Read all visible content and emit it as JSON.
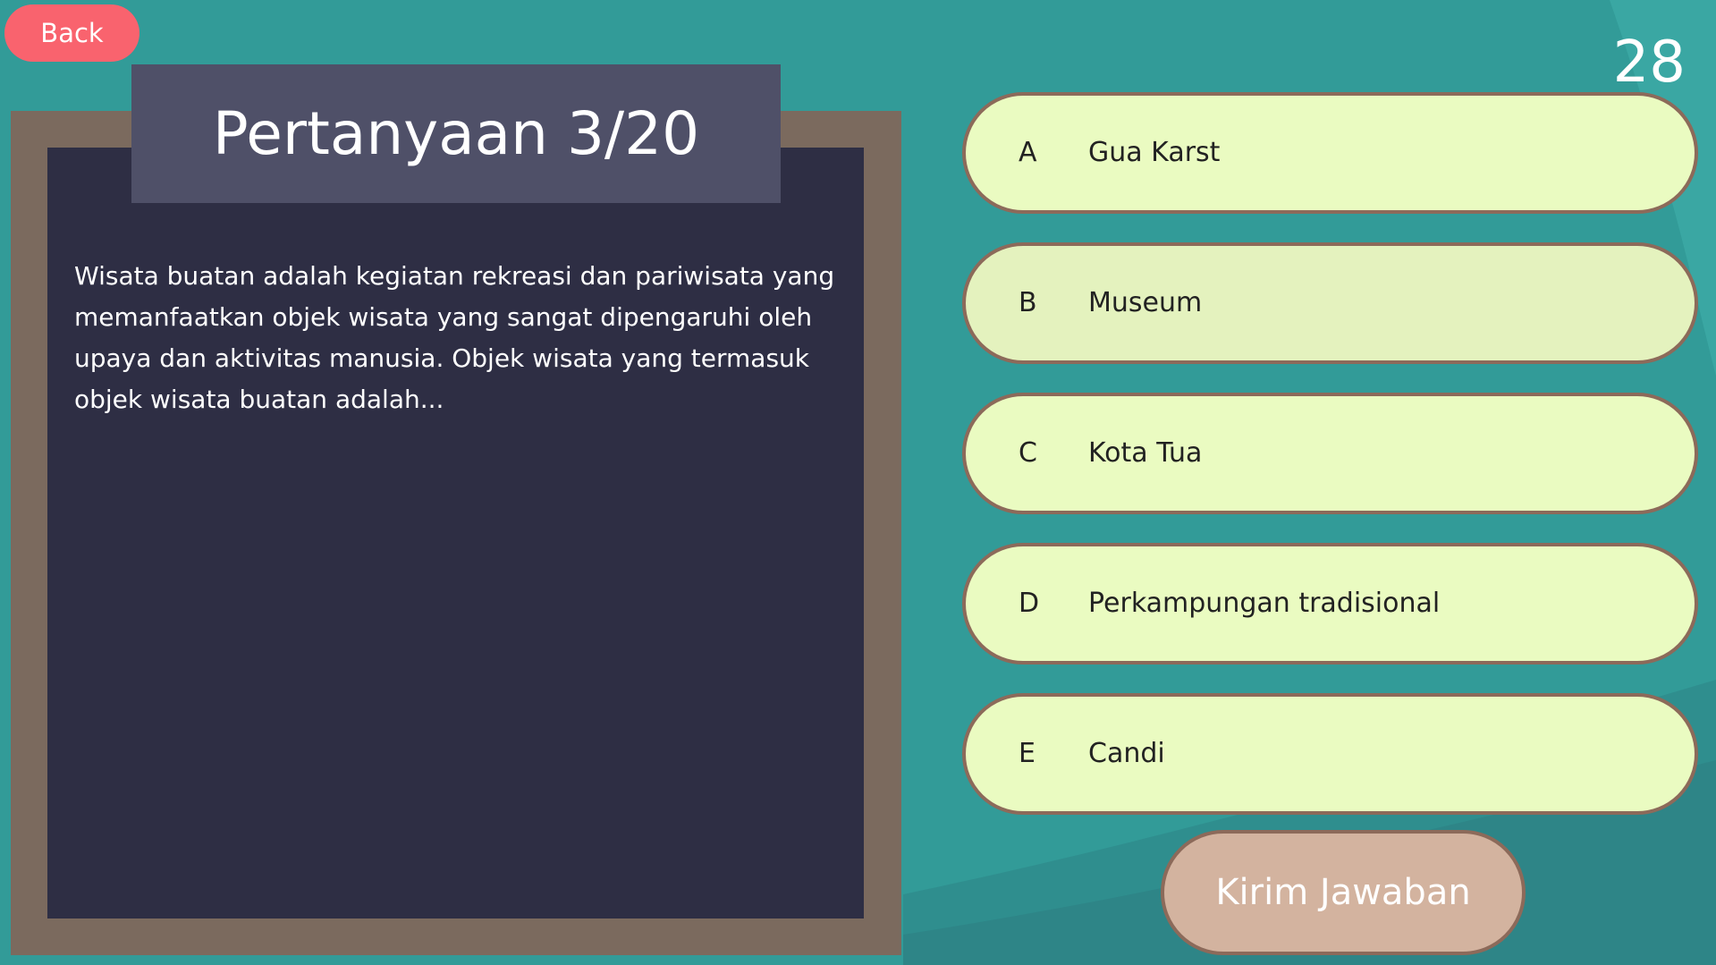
{
  "back_label": "Back",
  "timer": "28",
  "question": {
    "title": "Pertanyaan 3/20",
    "text": "Wisata buatan adalah kegiatan rekreasi dan pariwisata yang memanfaatkan objek wisata yang sangat dipengaruhi oleh upaya dan aktivitas manusia. Objek wisata yang termasuk objek wisata buatan adalah..."
  },
  "options": [
    {
      "letter": "A",
      "text": "Gua Karst"
    },
    {
      "letter": "B",
      "text": "Museum"
    },
    {
      "letter": "C",
      "text": "Kota Tua"
    },
    {
      "letter": "D",
      "text": "Perkampungan tradisional"
    },
    {
      "letter": "E",
      "text": "Candi"
    }
  ],
  "selected_option": "B",
  "submit_label": "Kirim Jawaban",
  "colors": {
    "background": "#329b98",
    "back_button": "#f9636e",
    "board_frame": "#7b6a5e",
    "board": "#2e2e44",
    "title_box": "#4f5068",
    "option": "#eafbc1",
    "submit": "#d3b39f"
  }
}
